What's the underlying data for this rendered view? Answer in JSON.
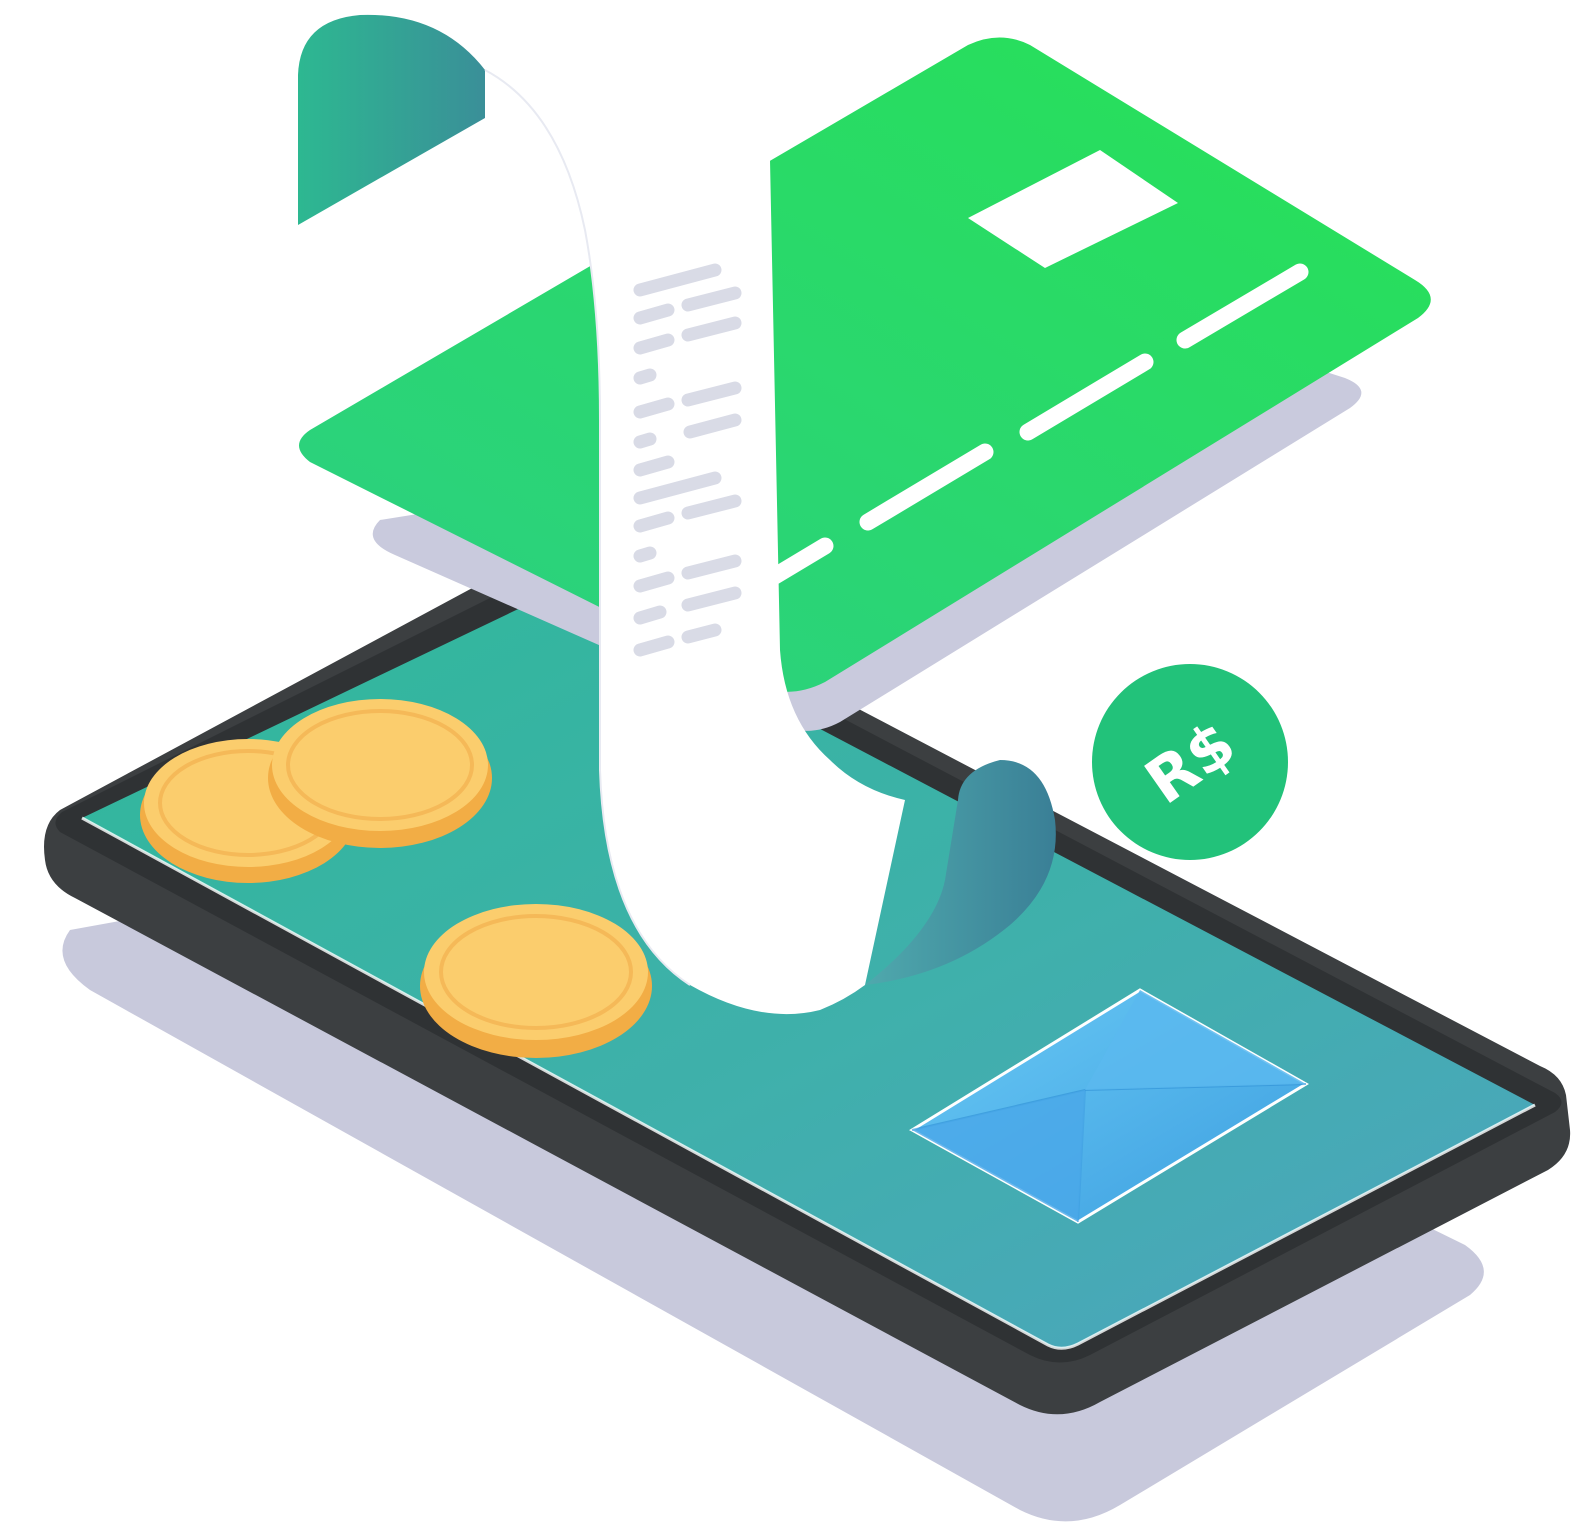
{
  "illustration": {
    "currency_badge": {
      "label": "R$",
      "color": "#22c27a"
    },
    "icons": [
      "smartphone-icon",
      "credit-card-icon",
      "receipt-icon",
      "coin-icon",
      "envelope-icon",
      "currency-badge-icon"
    ],
    "colors": {
      "card_green": "#27d65c",
      "card_green_dark": "#22c27a",
      "phone_frame": "#3c3f41",
      "phone_screen": "#3fb3a8",
      "receipt_paper": "#ffffff",
      "receipt_lines": "#d9dbe6",
      "coin_face": "#fbcd6d",
      "coin_edge": "#f2ad45",
      "envelope": "#4fb0ea",
      "shadow": "#c4c5d9"
    }
  }
}
